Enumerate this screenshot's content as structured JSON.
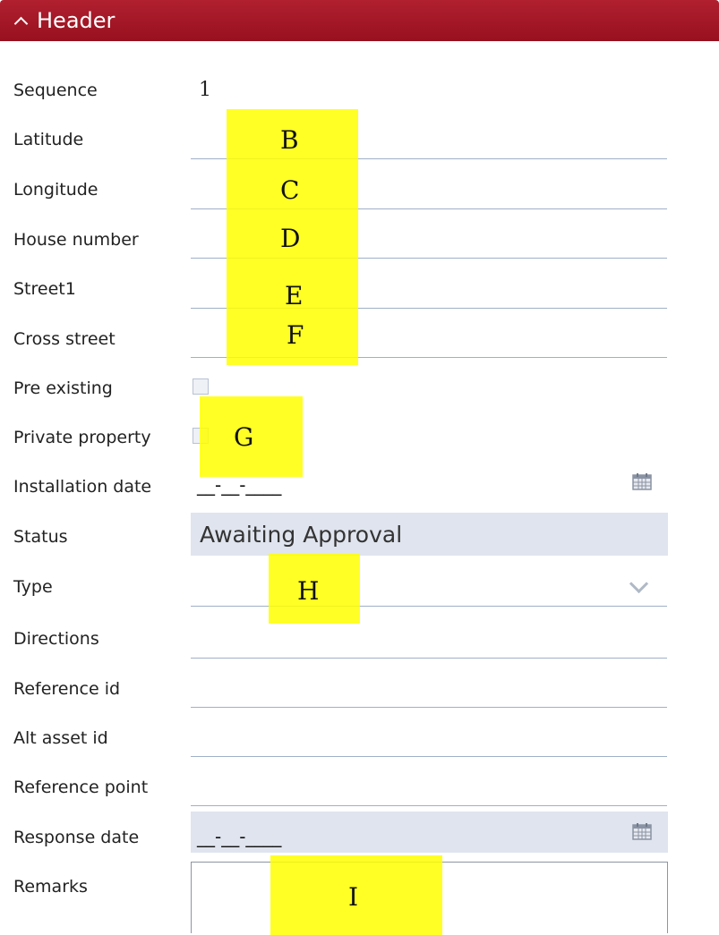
{
  "header": {
    "title": "Header",
    "accent_color": "#a8192b",
    "collapse_icon": "chevron-up-icon"
  },
  "fields": {
    "sequence": {
      "label": "Sequence",
      "value": "1"
    },
    "latitude": {
      "label": "Latitude",
      "value": ""
    },
    "longitude": {
      "label": "Longitude",
      "value": ""
    },
    "house_number": {
      "label": "House number",
      "value": ""
    },
    "street1": {
      "label": "Street1",
      "value": ""
    },
    "cross_street": {
      "label": "Cross street",
      "value": ""
    },
    "pre_existing": {
      "label": "Pre existing",
      "checked": false
    },
    "private_property": {
      "label": "Private property",
      "checked": false
    },
    "installation_date": {
      "label": "Installation date",
      "mask": "__-__-____",
      "icon": "calendar-icon"
    },
    "status": {
      "label": "Status",
      "value": "Awaiting Approval"
    },
    "type": {
      "label": "Type",
      "value": "",
      "icon": "chevron-down-icon"
    },
    "directions": {
      "label": "Directions",
      "value": ""
    },
    "reference_id": {
      "label": "Reference id",
      "value": ""
    },
    "alt_asset_id": {
      "label": "Alt asset id",
      "value": ""
    },
    "reference_point": {
      "label": "Reference point",
      "value": ""
    },
    "response_date": {
      "label": "Response date",
      "mask": "__-__-____",
      "icon": "calendar-icon"
    },
    "remarks": {
      "label": "Remarks",
      "value": ""
    }
  },
  "annotations": {
    "color": "#ffff00",
    "letters": [
      "B",
      "C",
      "D",
      "E",
      "F",
      "G",
      "H",
      "I"
    ]
  }
}
